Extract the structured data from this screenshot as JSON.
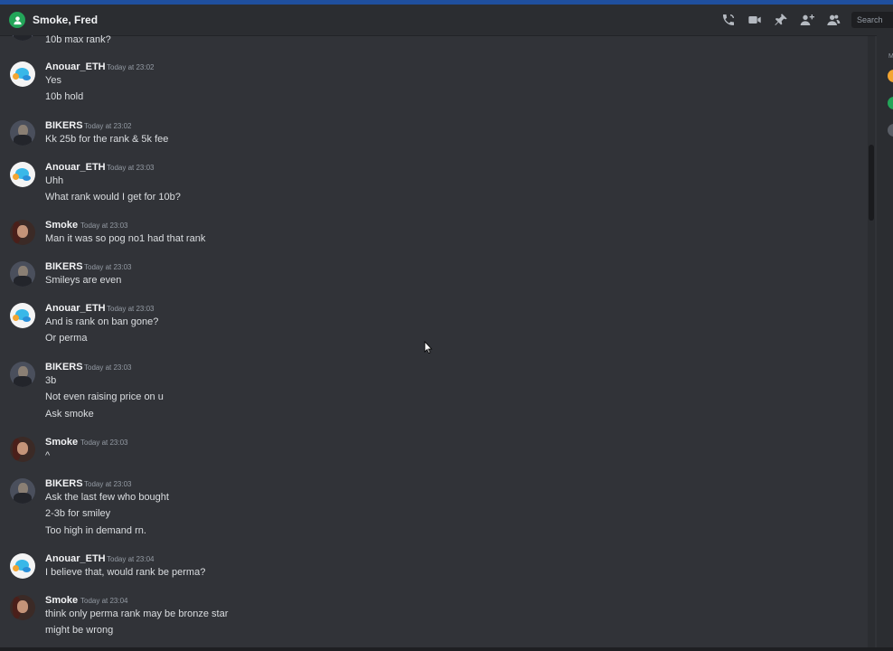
{
  "header": {
    "title": "Smoke, Fred",
    "search_placeholder": "Search",
    "icons": [
      "dm-group-icon",
      "start-voice-call-icon",
      "start-video-call-icon",
      "pinned-messages-icon",
      "add-friends-to-dm-icon",
      "show-member-list-icon"
    ]
  },
  "colors": {
    "background": "#313338",
    "header": "#2b2d31",
    "accent_green": "#23a559",
    "text": "#dbdee1",
    "muted": "#949ba4"
  },
  "messages": {
    "m0": {
      "lines": [
        "10b max rank?"
      ]
    },
    "m1": {
      "author": "Anouar_ETH",
      "time": "Today at 23:02",
      "lines": [
        "Yes",
        "10b hold"
      ]
    },
    "m2": {
      "author": "BIKERS",
      "time": "Today at 23:02",
      "lines": [
        "Kk 25b for the rank & 5k fee"
      ]
    },
    "m3": {
      "author": "Anouar_ETH",
      "time": "Today at 23:03",
      "lines": [
        "Uhh",
        "What rank would I get for 10b?"
      ]
    },
    "m4": {
      "author": "Smoke",
      "time": "Today at 23:03",
      "lines": [
        "Man it was so pog no1 had that rank"
      ]
    },
    "m5": {
      "author": "BIKERS",
      "time": "Today at 23:03",
      "lines": [
        "Smileys are even"
      ]
    },
    "m6": {
      "author": "Anouar_ETH",
      "time": "Today at 23:03",
      "lines": [
        "And is rank on ban gone?",
        "Or perma"
      ]
    },
    "m7": {
      "author": "BIKERS",
      "time": "Today at 23:03",
      "lines": [
        "3b",
        "Not even raising price on u",
        "Ask smoke"
      ]
    },
    "m8": {
      "author": "Smoke",
      "time": "Today at 23:03",
      "lines": [
        "^"
      ]
    },
    "m9": {
      "author": "BIKERS",
      "time": "Today at 23:03",
      "lines": [
        "Ask the last few who bought",
        "2-3b for smiley",
        "Too high in demand rn."
      ]
    },
    "m10": {
      "author": "Anouar_ETH",
      "time": "Today at 23:04",
      "lines": [
        "I believe that, would rank be perma?"
      ]
    },
    "m11": {
      "author": "Smoke",
      "time": "Today at 23:04",
      "lines": [
        "think only perma rank may be bronze star",
        "might be wrong"
      ]
    }
  },
  "members_panel": {
    "header_letter": "M"
  }
}
